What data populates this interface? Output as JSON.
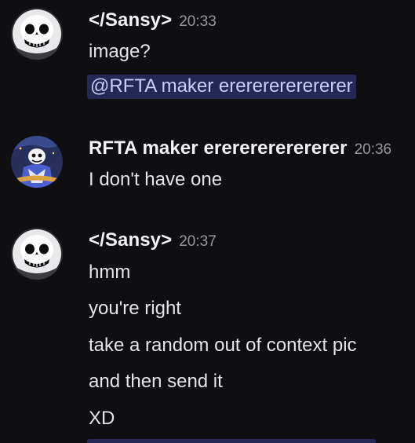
{
  "messages": [
    {
      "author": "</Sansy>",
      "time": "20:33",
      "avatar_icon": "skull-avatar-icon",
      "lines": [
        "image?"
      ],
      "mention": "@RFTA maker erererererererer"
    },
    {
      "author": "RFTA maker erererererererer",
      "time": "20:36",
      "avatar_icon": "character-avatar-icon",
      "lines": [
        "I don't have one"
      ]
    },
    {
      "author": "</Sansy>",
      "time": "20:37",
      "avatar_icon": "skull-avatar-icon",
      "lines": [
        "hmm",
        "you're right",
        "take a random out of context pic",
        "and then send it",
        "XD"
      ]
    }
  ],
  "colors": {
    "background": "#0f0f12",
    "text": "#e3e5e8",
    "timestamp": "#96989d",
    "mention_bg": "#5865f24d",
    "mention_text": "#c9cdfb"
  }
}
